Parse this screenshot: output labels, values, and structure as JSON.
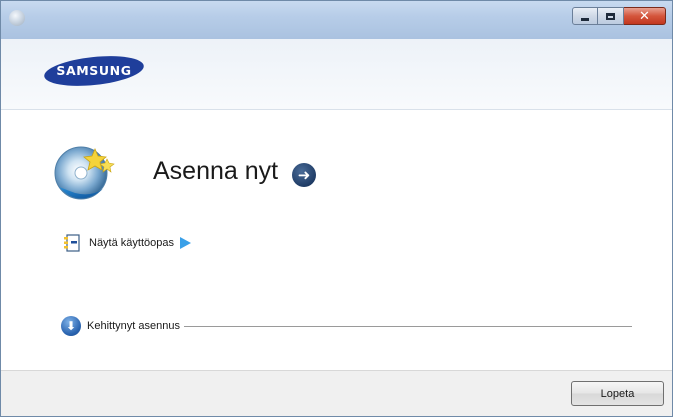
{
  "window": {
    "controls": {
      "minimize_icon": "minimize-icon",
      "maximize_icon": "maximize-icon",
      "close_icon": "close-icon"
    }
  },
  "header": {
    "logo_text": "SAMSUNG",
    "logo_color": "#1f3e9b"
  },
  "main": {
    "install_title": "Asenna nyt",
    "install_icon": "cd-install-icon",
    "go_icon": "arrow-right-circle-icon",
    "user_guide_label": "Näytä käyttöopas",
    "user_guide_icon": "manual-icon",
    "user_guide_arrow_icon": "play-arrow-icon",
    "advanced_label": "Kehittynyt asennus",
    "advanced_icon": "arrow-down-circle-icon"
  },
  "footer": {
    "finish_label": "Lopeta"
  }
}
